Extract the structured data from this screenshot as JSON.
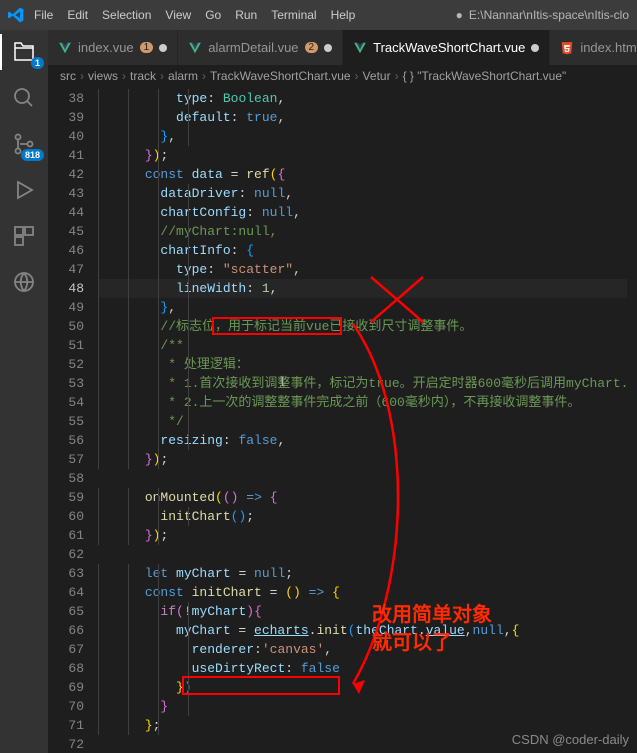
{
  "menu": [
    "File",
    "Edit",
    "Selection",
    "View",
    "Go",
    "Run",
    "Terminal",
    "Help"
  ],
  "title_path": "E:\\Nannar\\nItis-space\\nItis-clo",
  "activity_badges": {
    "explorer": "1",
    "scm": "818"
  },
  "tabs": [
    {
      "label": "index.vue",
      "badge": "1",
      "type": "vue",
      "dirty": true,
      "active": false
    },
    {
      "label": "alarmDetail.vue",
      "badge": "2",
      "type": "vue",
      "dirty": true,
      "active": false
    },
    {
      "label": "TrackWaveShortChart.vue",
      "badge": "",
      "type": "vue",
      "dirty": true,
      "active": true
    },
    {
      "label": "index.html",
      "badge": "",
      "type": "html",
      "dirty": false,
      "active": false
    }
  ],
  "breadcrumbs": [
    "src",
    "views",
    "track",
    "alarm",
    "TrackWaveShortChart.vue",
    "Vetur",
    "{ } \"TrackWaveShortChart.vue\""
  ],
  "line_start": 38,
  "line_end": 72,
  "current_line": 48,
  "annotation_text": [
    "改用简单对象",
    "就可以了"
  ],
  "watermark": "CSDN @coder-daily",
  "code": {
    "l38": {
      "i": 5,
      "t": [
        [
          "prop",
          "type"
        ],
        [
          "punc",
          ": "
        ],
        [
          "type",
          "Boolean"
        ],
        [
          "punc",
          ","
        ]
      ]
    },
    "l39": {
      "i": 5,
      "t": [
        [
          "prop",
          "default"
        ],
        [
          "punc",
          ": "
        ],
        [
          "bool",
          "true"
        ],
        [
          "punc",
          ","
        ]
      ]
    },
    "l40": {
      "i": 4,
      "t": [
        [
          "brace-b",
          "}"
        ],
        [
          "punc",
          ","
        ]
      ]
    },
    "l41": {
      "i": 3,
      "t": [
        [
          "brace-p",
          "}"
        ],
        [
          "brace-y",
          ")"
        ],
        [
          "punc",
          ";"
        ]
      ]
    },
    "l42": {
      "i": 3,
      "t": [
        [
          "kw2",
          "const "
        ],
        [
          "var",
          "data"
        ],
        [
          "punc",
          " = "
        ],
        [
          "fn",
          "ref"
        ],
        [
          "brace-y",
          "("
        ],
        [
          "brace-p",
          "{"
        ]
      ]
    },
    "l43": {
      "i": 4,
      "t": [
        [
          "prop",
          "dataDriver"
        ],
        [
          "punc",
          ": "
        ],
        [
          "bool",
          "null"
        ],
        [
          "punc",
          ","
        ]
      ]
    },
    "l44": {
      "i": 4,
      "t": [
        [
          "prop",
          "chartConfig"
        ],
        [
          "punc",
          ": "
        ],
        [
          "bool",
          "null"
        ],
        [
          "punc",
          ","
        ]
      ]
    },
    "l45": {
      "i": 4,
      "t": [
        [
          "cmt",
          "//myChart:null,"
        ]
      ]
    },
    "l46": {
      "i": 4,
      "t": [
        [
          "prop",
          "chartInfo"
        ],
        [
          "punc",
          ": "
        ],
        [
          "brace-b",
          "{"
        ]
      ]
    },
    "l47": {
      "i": 5,
      "t": [
        [
          "prop",
          "type"
        ],
        [
          "punc",
          ": "
        ],
        [
          "str",
          "\"scatter\""
        ],
        [
          "punc",
          ","
        ]
      ]
    },
    "l48": {
      "i": 5,
      "t": [
        [
          "prop",
          "lineWidth"
        ],
        [
          "punc",
          ": "
        ],
        [
          "num",
          "1"
        ],
        [
          "punc",
          ","
        ]
      ]
    },
    "l49": {
      "i": 4,
      "t": [
        [
          "brace-b",
          "}"
        ],
        [
          "punc",
          ","
        ]
      ]
    },
    "l50": {
      "i": 4,
      "t": [
        [
          "cmt",
          "//标志位，用于标记当前vue已接收到尺寸调整事件。"
        ]
      ]
    },
    "l51": {
      "i": 4,
      "t": [
        [
          "cmt",
          "/**"
        ]
      ]
    },
    "l52": {
      "i": 4,
      "t": [
        [
          "cmt",
          " * 处理逻辑："
        ]
      ]
    },
    "l53": {
      "i": 4,
      "t": [
        [
          "cmt",
          " * 1.首次接收到调整事件，标记为true。开启定时器600毫秒后调用myChart."
        ]
      ]
    },
    "l54": {
      "i": 4,
      "t": [
        [
          "cmt",
          " * 2.上一次的调整整事件完成之前（600毫秒内），不再接收调整事件。"
        ]
      ]
    },
    "l55": {
      "i": 4,
      "t": [
        [
          "cmt",
          " */"
        ]
      ]
    },
    "l56": {
      "i": 4,
      "t": [
        [
          "prop",
          "resizing"
        ],
        [
          "punc",
          ": "
        ],
        [
          "bool",
          "false"
        ],
        [
          "punc",
          ","
        ]
      ]
    },
    "l57": {
      "i": 3,
      "t": [
        [
          "brace-p",
          "}"
        ],
        [
          "brace-y",
          ")"
        ],
        [
          "punc",
          ";"
        ]
      ]
    },
    "l58": {
      "i": 0,
      "t": []
    },
    "l59": {
      "i": 3,
      "t": [
        [
          "fn",
          "onMounted"
        ],
        [
          "brace-y",
          "("
        ],
        [
          "brace-p",
          "()"
        ],
        [
          "punc",
          " "
        ],
        [
          "kw2",
          "=>"
        ],
        [
          "punc",
          " "
        ],
        [
          "brace-p",
          "{"
        ]
      ]
    },
    "l60": {
      "i": 4,
      "t": [
        [
          "fn",
          "initChart"
        ],
        [
          "brace-b",
          "()"
        ],
        [
          "punc",
          ";"
        ]
      ]
    },
    "l61": {
      "i": 3,
      "t": [
        [
          "brace-p",
          "}"
        ],
        [
          "brace-y",
          ")"
        ],
        [
          "punc",
          ";"
        ]
      ]
    },
    "l62": {
      "i": 0,
      "t": []
    },
    "l63": {
      "i": 3,
      "t": [
        [
          "kw2",
          "let "
        ],
        [
          "var",
          "myChart"
        ],
        [
          "punc",
          " = "
        ],
        [
          "bool",
          "null"
        ],
        [
          "punc",
          ";"
        ]
      ]
    },
    "l64": {
      "i": 3,
      "t": [
        [
          "kw2",
          "const "
        ],
        [
          "fn",
          "initChart"
        ],
        [
          "punc",
          " = "
        ],
        [
          "brace-y",
          "()"
        ],
        [
          "punc",
          " "
        ],
        [
          "kw2",
          "=>"
        ],
        [
          "punc",
          " "
        ],
        [
          "brace-y",
          "{"
        ]
      ]
    },
    "l65": {
      "i": 4,
      "t": [
        [
          "kw",
          "if"
        ],
        [
          "brace-p",
          "("
        ],
        [
          "punc",
          "!"
        ],
        [
          "var",
          "myChart"
        ],
        [
          "brace-p",
          ")"
        ],
        [
          "brace-p",
          "{"
        ]
      ]
    },
    "l66": {
      "i": 5,
      "t": [
        [
          "var",
          "myChart"
        ],
        [
          "punc",
          " = "
        ],
        [
          "var u-var",
          "echarts"
        ],
        [
          "punc",
          "."
        ],
        [
          "fn",
          "init"
        ],
        [
          "brace-b",
          "("
        ],
        [
          "var",
          "theChart"
        ],
        [
          "punc",
          "."
        ],
        [
          "var u-var",
          "value"
        ],
        [
          "punc",
          ","
        ],
        [
          "bool",
          "null"
        ],
        [
          "punc",
          ","
        ],
        [
          "brace-y",
          "{"
        ]
      ]
    },
    "l67": {
      "i": 6,
      "t": [
        [
          "prop",
          "renderer"
        ],
        [
          "punc",
          ":"
        ],
        [
          "str",
          "'canvas'"
        ],
        [
          "punc",
          ","
        ]
      ]
    },
    "l68": {
      "i": 6,
      "t": [
        [
          "prop",
          "useDirtyRect"
        ],
        [
          "punc",
          ": "
        ],
        [
          "bool",
          "false"
        ]
      ]
    },
    "l69": {
      "i": 5,
      "t": [
        [
          "brace-y",
          "}"
        ],
        [
          "brace-b",
          ")"
        ]
      ]
    },
    "l70": {
      "i": 4,
      "t": [
        [
          "brace-p",
          "}"
        ]
      ]
    },
    "l71": {
      "i": 3,
      "t": [
        [
          "brace-y",
          "}"
        ],
        [
          "punc",
          ";"
        ]
      ]
    },
    "l72": {
      "i": 0,
      "t": []
    }
  }
}
